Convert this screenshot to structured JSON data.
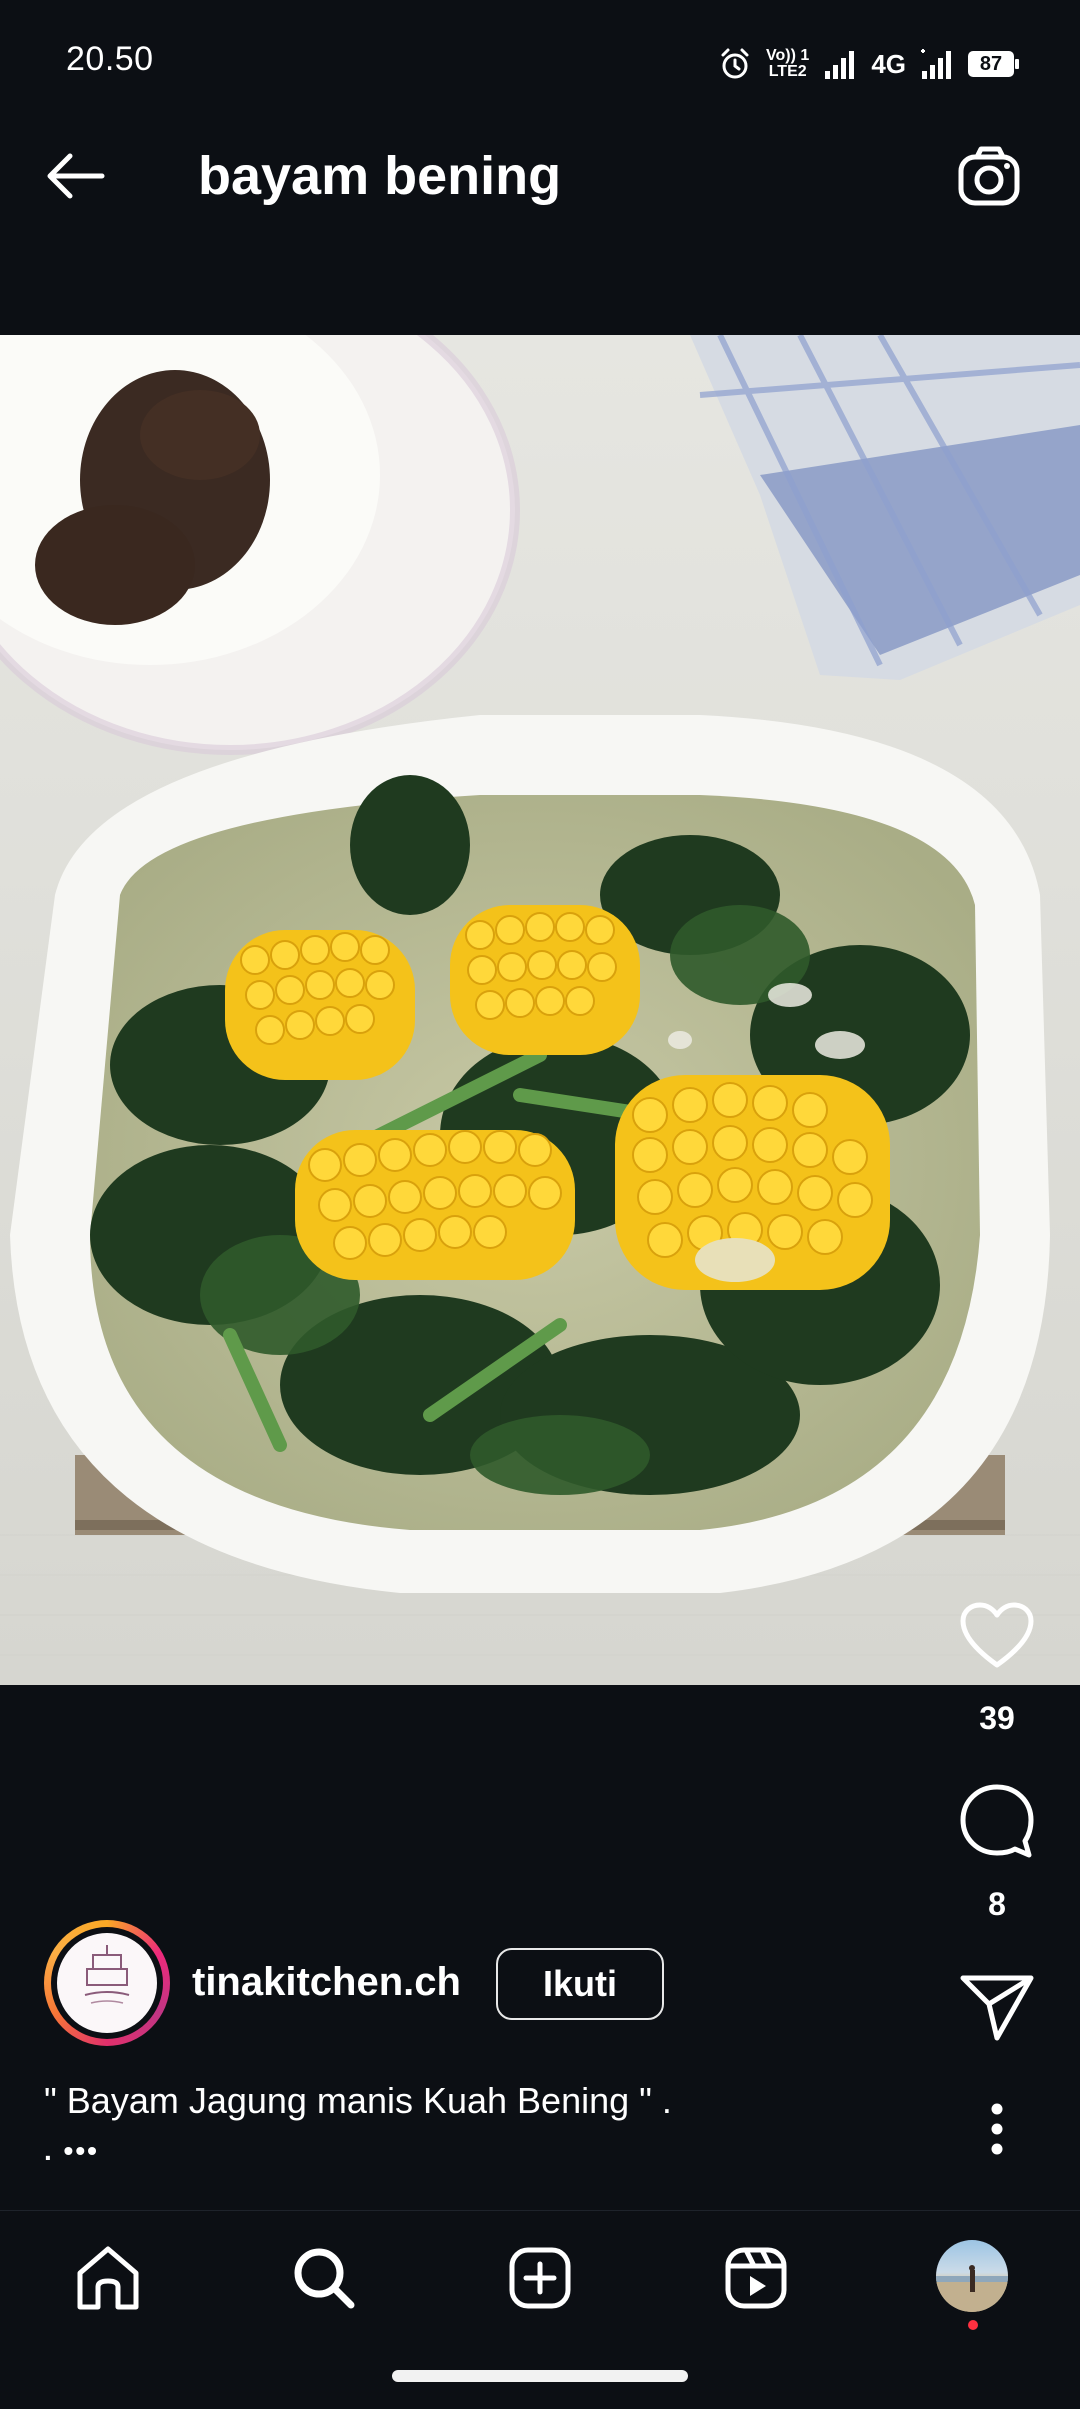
{
  "status_bar": {
    "time": "20.50",
    "volte_label": "Vo)) 1",
    "lte_label": "LTE2",
    "network_label": "4G",
    "battery_level": "87"
  },
  "header": {
    "title": "bayam bening"
  },
  "post": {
    "likes": "39",
    "comments": "8",
    "username": "tinakitchen.ch",
    "follow_label": "Ikuti",
    "caption": "\" Bayam Jagung manis Kuah Bening \" .",
    "caption_more": ". •••"
  },
  "colors": {
    "background": "#0c0f14",
    "text": "#ffffff",
    "notification_dot": "#ff3040"
  },
  "icons": {
    "back": "arrow-left-icon",
    "camera": "camera-icon",
    "like": "heart-icon",
    "comment": "comment-icon",
    "share": "send-icon",
    "more": "more-vertical-icon",
    "home": "home-icon",
    "search": "search-icon",
    "create": "plus-square-icon",
    "reels": "reels-icon"
  }
}
